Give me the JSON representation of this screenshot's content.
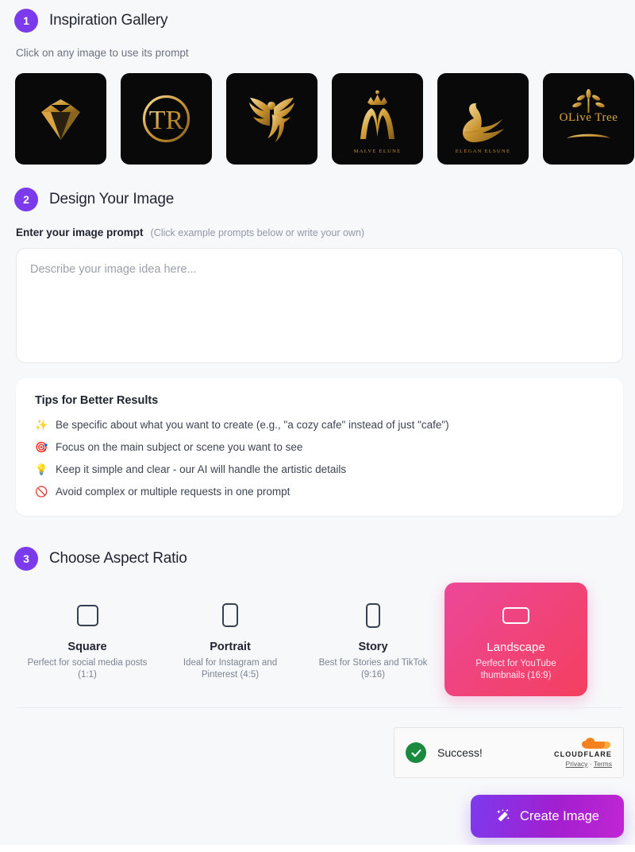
{
  "accent": {
    "purple": "#7c3aed",
    "pink": "#ec4899",
    "red": "#f43f5e",
    "green": "#1a8a3f",
    "gold": "#d9a441"
  },
  "gallery": {
    "step": "1",
    "title": "Inspiration Gallery",
    "subtitle": "Click on any image to use its prompt",
    "items": [
      {
        "name": "diamond-logo",
        "caption": ""
      },
      {
        "name": "tr-monogram-logo",
        "caption": ""
      },
      {
        "name": "phoenix-logo",
        "caption": ""
      },
      {
        "name": "crown-m-logo",
        "caption": "MALVE ELUNE"
      },
      {
        "name": "swan-logo",
        "caption": "ELEGAN ELSUNE"
      },
      {
        "name": "olive-tree-logo",
        "caption": "OLive Tree"
      }
    ]
  },
  "design": {
    "step": "2",
    "title": "Design Your Image",
    "label": "Enter your image prompt",
    "hint": "(Click example prompts below or write your own)",
    "placeholder": "Describe your image idea here...",
    "value": ""
  },
  "tips": {
    "title": "Tips for Better Results",
    "items": [
      {
        "icon": "✨",
        "icon_name": "sparkles-icon",
        "text": "Be specific about what you want to create (e.g., \"a cozy cafe\" instead of just \"cafe\")"
      },
      {
        "icon": "🎯",
        "icon_name": "target-icon",
        "text": "Focus on the main subject or scene you want to see"
      },
      {
        "icon": "💡",
        "icon_name": "lightbulb-icon",
        "text": "Keep it simple and clear - our AI will handle the artistic details"
      },
      {
        "icon": "🚫",
        "icon_name": "prohibited-icon",
        "text": "Avoid complex or multiple requests in one prompt"
      }
    ]
  },
  "aspect": {
    "step": "3",
    "title": "Choose Aspect Ratio",
    "options": [
      {
        "name": "Square",
        "desc": "Perfect for social media posts (1:1)",
        "selected": false
      },
      {
        "name": "Portrait",
        "desc": "Ideal for Instagram and Pinterest (4:5)",
        "selected": false
      },
      {
        "name": "Story",
        "desc": "Best for Stories and TikTok (9:16)",
        "selected": false
      },
      {
        "name": "Landscape",
        "desc": "Perfect for YouTube thumbnails (16:9)",
        "selected": true
      }
    ]
  },
  "turnstile": {
    "status": "Success!",
    "brand": "CLOUDFLARE",
    "privacy": "Privacy",
    "separator": "·",
    "terms": "Terms"
  },
  "footer": {
    "create_label": "Create Image"
  }
}
